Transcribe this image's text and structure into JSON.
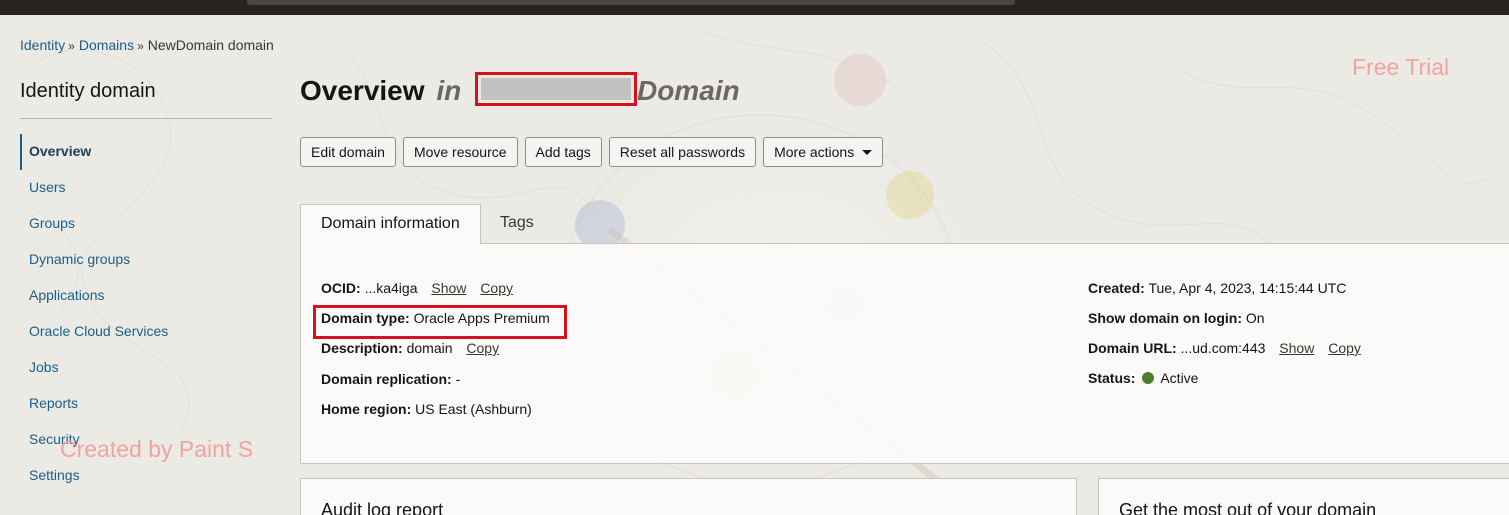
{
  "breadcrumb": {
    "items": [
      "Identity",
      "Domains"
    ],
    "current": "NewDomain domain",
    "separator": "»"
  },
  "sidebar": {
    "title": "Identity domain",
    "items": [
      {
        "label": "Overview",
        "active": true
      },
      {
        "label": "Users"
      },
      {
        "label": "Groups"
      },
      {
        "label": "Dynamic groups"
      },
      {
        "label": "Applications"
      },
      {
        "label": "Oracle Cloud Services"
      },
      {
        "label": "Jobs"
      },
      {
        "label": "Reports"
      },
      {
        "label": "Security"
      },
      {
        "label": "Settings"
      }
    ]
  },
  "header": {
    "title": "Overview",
    "in_word": "in",
    "domain_word": "Domain"
  },
  "watermarks": {
    "free_trial": "Free Trial",
    "created_by": "Created by Paint S"
  },
  "actions": {
    "edit_domain": "Edit domain",
    "move_resource": "Move resource",
    "add_tags": "Add tags",
    "reset_passwords": "Reset all passwords",
    "more_actions": "More actions"
  },
  "tabs": {
    "domain_information": "Domain information",
    "tags": "Tags"
  },
  "info": {
    "ocid_label": "OCID:",
    "ocid_value": "...ka4iga",
    "show": "Show",
    "copy": "Copy",
    "domain_type_label": "Domain type:",
    "domain_type_value": "Oracle Apps Premium",
    "description_label": "Description:",
    "description_value": "domain",
    "replication_label": "Domain replication:",
    "replication_value": "-",
    "home_region_label": "Home region:",
    "home_region_value": "US East (Ashburn)",
    "created_label": "Created:",
    "created_value": "Tue, Apr 4, 2023, 14:15:44 UTC",
    "show_on_login_label": "Show domain on login:",
    "show_on_login_value": "On",
    "url_label": "Domain URL:",
    "url_value": "...ud.com:443",
    "status_label": "Status:",
    "status_value": "Active",
    "status_color": "#4b7d2a"
  },
  "cards": {
    "audit_title": "Audit log report",
    "getmost_title": "Get the most out of your domain"
  },
  "colors": {
    "accent": "#1a5e8a",
    "highlight_red": "#d8121d",
    "watermark_pink": "#f0a4a0"
  }
}
